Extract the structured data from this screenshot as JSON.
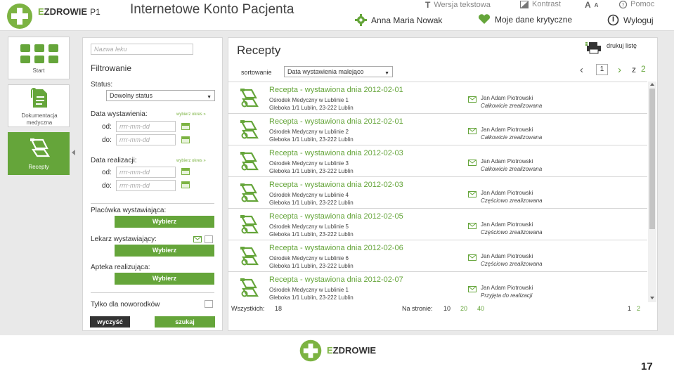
{
  "header": {
    "logo_prefix": "E",
    "logo_rest": "ZDROWIE",
    "logo_suffix": "P1",
    "title": "Internetowe Konto Pacjenta",
    "links": {
      "text_version": "Wersja tekstowa",
      "contrast": "Kontrast",
      "font_size": "A",
      "help": "Pomoc"
    },
    "user_name": "Anna Maria Nowak",
    "critical_data": "Moje dane krytyczne",
    "logout": "Wyloguj"
  },
  "nav": {
    "items": [
      {
        "label": "Start"
      },
      {
        "label": "Dokumentacja medyczna"
      },
      {
        "label": "Recepty"
      }
    ]
  },
  "filter": {
    "search_placeholder": "Nazwa leku",
    "heading": "Filtrowanie",
    "status_label": "Status:",
    "status_value": "Dowolny status",
    "issue_date_label": "Data wystawienia:",
    "issue_period_link": "wybierz okres »",
    "from_label": "od:",
    "to_label": "do:",
    "date_placeholder": "rrrr-mm-dd",
    "realization_date_label": "Data realizacji:",
    "realization_period_link": "wybierz okres »",
    "facility_label": "Placówka wystawiająca:",
    "doctor_label": "Lekarz wystawiający:",
    "pharmacy_label": "Apteka realizująca:",
    "choose_label": "Wybierz",
    "newborns_label": "Tylko dla noworodków",
    "clear_button": "wyczyść",
    "search_button": "szukaj"
  },
  "main": {
    "title": "Recepty",
    "print_label": "drukuj listę",
    "sort_label": "sortowanie",
    "sort_value": "Data wystawienia malejąco",
    "page_current": "1",
    "page_of": "z",
    "page_total": "2",
    "prescriptions": [
      {
        "title": "Recepta - wystawiona dnia 2012-02-01",
        "facility": "Ośrodek Medyczny w Lublinie 1",
        "address": "Gleboka 1/1 Lublin, 23-222 Lublin",
        "doctor": "Jan Adam Piotrowski",
        "status": "Całkowicie zrealizowana"
      },
      {
        "title": "Recepta - wystawiona dnia 2012-02-01",
        "facility": "Ośrodek Medyczny w Lublinie 2",
        "address": "Gleboka 1/1 Lublin, 23-222 Lublin",
        "doctor": "Jan Adam Piotrowski",
        "status": "Całkowicie zrealizowana"
      },
      {
        "title": "Recepta - wystawiona dnia 2012-02-03",
        "facility": "Ośrodek Medyczny w Lublinie 3",
        "address": "Gleboka 1/1 Lublin, 23-222 Lublin",
        "doctor": "Jan Adam Piotrowski",
        "status": "Całkowicie zrealizowana"
      },
      {
        "title": "Recepta - wystawiona dnia 2012-02-03",
        "facility": "Ośrodek Medyczny w Lublinie 4",
        "address": "Gleboka 1/1 Lublin, 23-222 Lublin",
        "doctor": "Jan Adam Piotrowski",
        "status": "Częściowo zrealizowana"
      },
      {
        "title": "Recepta - wystawiona dnia 2012-02-05",
        "facility": "Ośrodek Medyczny w Lublinie 5",
        "address": "Gleboka 1/1 Lublin, 23-222 Lublin",
        "doctor": "Jan Adam Piotrowski",
        "status": "Częściowo zrealizowana"
      },
      {
        "title": "Recepta - wystawiona dnia 2012-02-06",
        "facility": "Ośrodek Medyczny w Lublinie 6",
        "address": "Gleboka 1/1 Lublin, 23-222 Lublin",
        "doctor": "Jan Adam Piotrowski",
        "status": "Częściowo zrealizowana"
      },
      {
        "title": "Recepta - wystawiona dnia 2012-02-07",
        "facility": "Ośrodek Medyczny w Lublinie 1",
        "address": "Gleboka 1/1 Lublin, 23-222 Lublin",
        "doctor": "Jan Adam Piotrowski",
        "status": "Przyjęta do realizacji"
      }
    ],
    "total_label": "Wszystkich:",
    "total_value": "18",
    "per_page_label": "Na stronie:",
    "per_page_options": [
      "10",
      "20",
      "40"
    ],
    "pages": [
      "1",
      "2"
    ]
  },
  "footer": {
    "logo_prefix": "E",
    "logo_rest": "ZDROWIE",
    "page_number": "17"
  },
  "colors": {
    "accent": "#65a53a",
    "background": "#e9e9e9"
  }
}
